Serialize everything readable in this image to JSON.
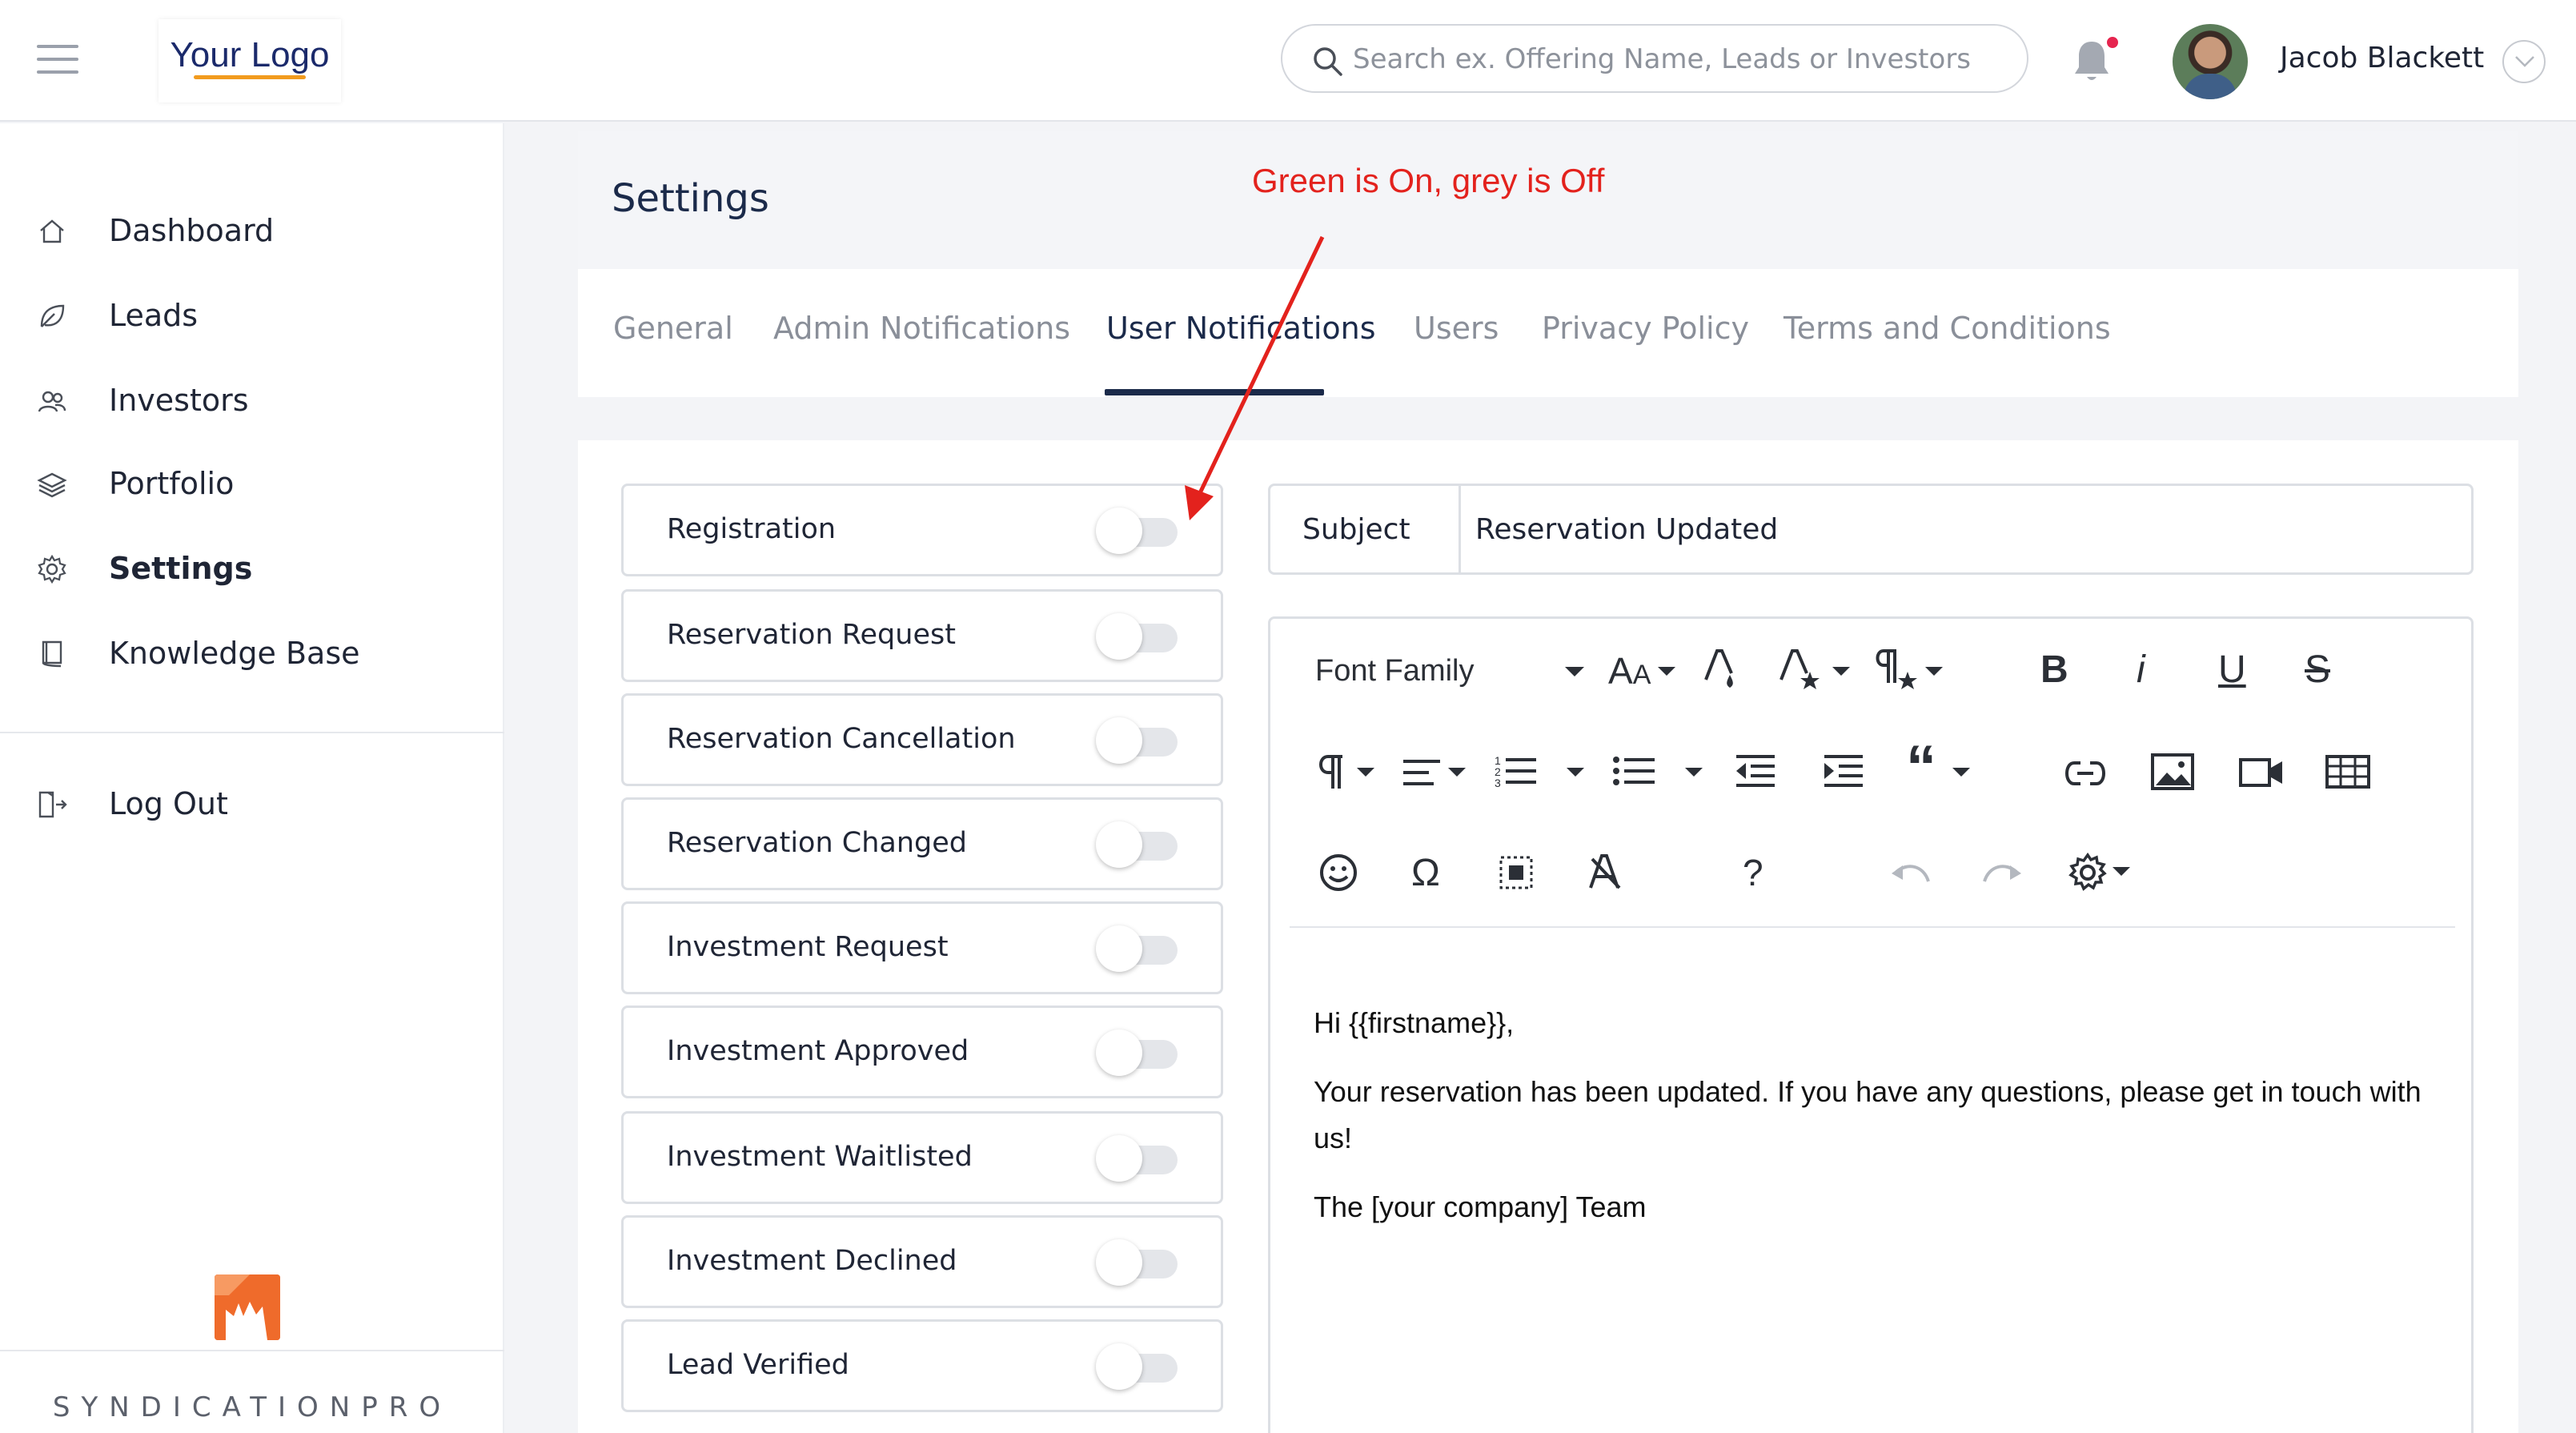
{
  "header": {
    "logo_text": "Your Logo",
    "search_placeholder": "Search ex. Offering Name, Leads or Investors",
    "user_name": "Jacob Blackett"
  },
  "sidebar": {
    "items": [
      {
        "label": "Dashboard",
        "icon": "home-icon"
      },
      {
        "label": "Leads",
        "icon": "leaf-icon"
      },
      {
        "label": "Investors",
        "icon": "users-icon"
      },
      {
        "label": "Portfolio",
        "icon": "layers-icon"
      },
      {
        "label": "Settings",
        "icon": "gear-icon",
        "active": true
      },
      {
        "label": "Knowledge Base",
        "icon": "book-icon"
      }
    ],
    "logout_label": "Log Out",
    "brand_name": "SYNDICATIONPRO"
  },
  "settings": {
    "title": "Settings",
    "tabs": [
      {
        "label": "General"
      },
      {
        "label": "Admin Notifications"
      },
      {
        "label": "User Notifications",
        "active": true
      },
      {
        "label": "Users"
      },
      {
        "label": "Privacy Policy"
      },
      {
        "label": "Terms and Conditions"
      }
    ]
  },
  "notifications": [
    {
      "label": "Registration",
      "enabled": false
    },
    {
      "label": "Reservation Request",
      "enabled": false
    },
    {
      "label": "Reservation Cancellation",
      "enabled": false
    },
    {
      "label": "Reservation Changed",
      "enabled": false
    },
    {
      "label": "Investment Request",
      "enabled": false
    },
    {
      "label": "Investment Approved",
      "enabled": false
    },
    {
      "label": "Investment Waitlisted",
      "enabled": false
    },
    {
      "label": "Investment Declined",
      "enabled": false
    },
    {
      "label": "Lead Verified",
      "enabled": false
    }
  ],
  "email": {
    "subject_label": "Subject",
    "subject_value": "Reservation Updated",
    "font_family_label": "Font Family",
    "help_label": "?",
    "body": {
      "greeting": "Hi {{firstname}},",
      "message": "Your reservation has been updated. If you have any questions, please get in touch with us!",
      "signature": "The [your company] Team"
    }
  },
  "annotation": {
    "text": "Green is On, grey is Off",
    "color": "#e3221d"
  },
  "colors": {
    "toggle_off": "#e4e6ea",
    "accent_underline": "#1b2a4a",
    "logo_underline": "#f29b1e",
    "notification_dot": "#e6254f",
    "brand_orange": "#ef6b2b"
  }
}
